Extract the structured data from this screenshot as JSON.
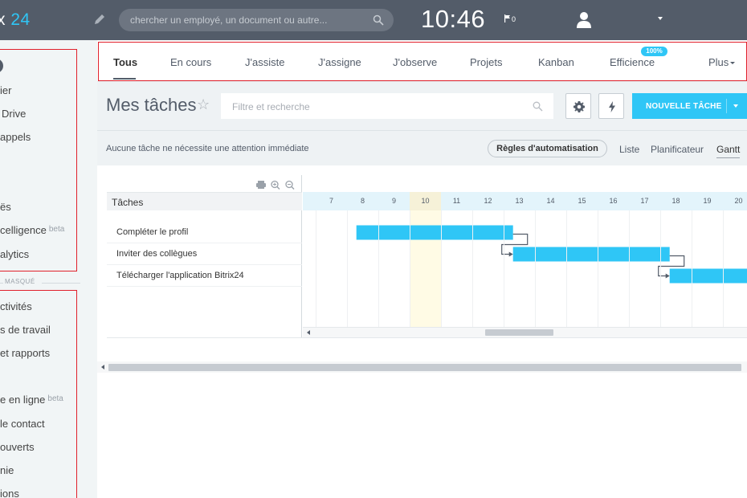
{
  "app": {
    "logo_text": "x ",
    "logo_number": "24"
  },
  "header": {
    "search_placeholder": "chercher un employé, un document ou autre...",
    "clock": "10:46",
    "flag_count": "0"
  },
  "sidebar": {
    "items_top": [
      {
        "label": "ier",
        "beta": ""
      },
      {
        "label": "Drive",
        "beta": ""
      },
      {
        "label": "appels",
        "beta": ""
      },
      {
        "label": "ës",
        "beta": ""
      },
      {
        "label": "celligence",
        "beta": "beta"
      },
      {
        "label": "alytics",
        "beta": ""
      }
    ],
    "masque_label": "MASQUÉ",
    "items_bottom": [
      {
        "label": "ctivités",
        "beta": ""
      },
      {
        "label": "s de travail",
        "beta": ""
      },
      {
        "label": "et rapports",
        "beta": ""
      },
      {
        "label": "e en ligne",
        "beta": "beta"
      },
      {
        "label": "le contact",
        "beta": ""
      },
      {
        "label": "ouverts",
        "beta": ""
      },
      {
        "label": "nie",
        "beta": ""
      },
      {
        "label": "ions",
        "beta": ""
      }
    ]
  },
  "tabs": [
    {
      "label": "Tous"
    },
    {
      "label": "En cours"
    },
    {
      "label": "J'assiste"
    },
    {
      "label": "J'assigne"
    },
    {
      "label": "J'observe"
    },
    {
      "label": "Projets"
    },
    {
      "label": "Kanban"
    },
    {
      "label": "Efficience"
    },
    {
      "label": "Plus"
    }
  ],
  "efficience_badge": "100%",
  "page": {
    "title": "Mes tâches",
    "filter_placeholder": "Filtre et recherche",
    "new_task_label": "NOUVELLE TÂCHE"
  },
  "info": {
    "message": "Aucune tâche ne nécessite une attention immédiate",
    "automation_label": "Règles d'automatisation",
    "views": [
      "Liste",
      "Planificateur",
      "Gantt"
    ]
  },
  "gantt": {
    "header_label": "Tâches",
    "days": [
      "7",
      "8",
      "9",
      "10",
      "11",
      "12",
      "13",
      "14",
      "15",
      "16",
      "17",
      "18",
      "19",
      "20"
    ],
    "today": "10",
    "tasks": [
      {
        "name": "Compléter le profil",
        "start_day": 8.3,
        "end_day": 13.3
      },
      {
        "name": "Inviter des collègues",
        "start_day": 13.3,
        "end_day": 18.3
      },
      {
        "name": "Télécharger l'application Bitrix24",
        "start_day": 18.3,
        "end_day": 21.5
      }
    ]
  },
  "colors": {
    "accent": "#2fc6f6",
    "topbar": "#535c69",
    "highlight_box": "#e0202b"
  }
}
